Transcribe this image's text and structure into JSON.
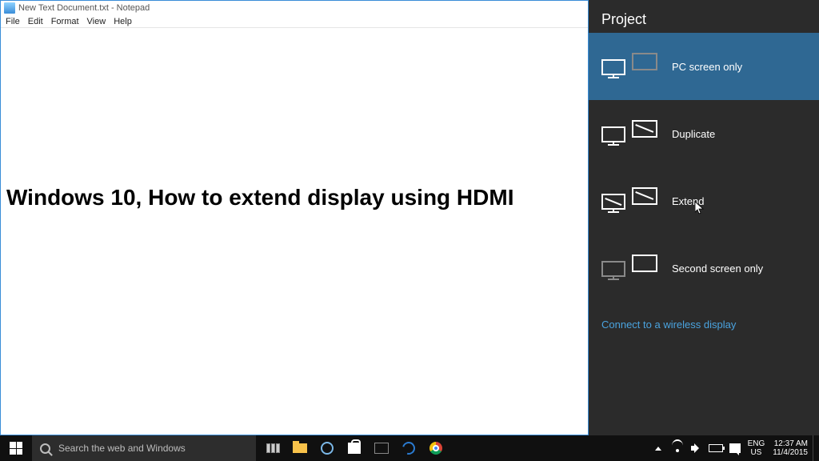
{
  "notepad": {
    "title": "New Text Document.txt - Notepad",
    "menus": {
      "file": "File",
      "edit": "Edit",
      "format": "Format",
      "view": "View",
      "help": "Help"
    },
    "content": "Windows 10, How to extend display using HDMI"
  },
  "project": {
    "title": "Project",
    "options": {
      "pc_only": "PC screen only",
      "duplicate": "Duplicate",
      "extend": "Extend",
      "second_only": "Second screen only"
    },
    "connect_link": "Connect to a wireless display"
  },
  "taskbar": {
    "search_placeholder": "Search the web and Windows",
    "lang_top": "ENG",
    "lang_bottom": "US",
    "time": "12:37 AM",
    "date": "11/4/2015"
  }
}
